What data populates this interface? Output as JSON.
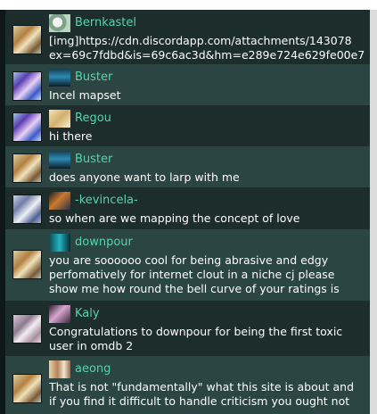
{
  "messages": [
    {
      "username": "Bernkastel",
      "mini_avatar_icon": "flower-avatar-icon",
      "lines": [
        "[img]https://cdn.discordapp.com/attachments/143078",
        "ex=69c7fdbd&is=69c6ac3d&hm=e289e724e629fe00e7"
      ]
    },
    {
      "username": "Buster",
      "mini_avatar_icon": "robot-avatar-icon",
      "lines": [
        "Incel mapset"
      ]
    },
    {
      "username": "Regou",
      "mini_avatar_icon": "blonde-avatar-icon",
      "lines": [
        "hi there"
      ]
    },
    {
      "username": "Buster",
      "mini_avatar_icon": "robot-avatar-icon",
      "lines": [
        "does anyone want to larp with me"
      ]
    },
    {
      "username": "-kevincela-",
      "mini_avatar_icon": "dark-hair-avatar-icon",
      "lines": [
        "so when are we mapping the concept of love"
      ]
    },
    {
      "username": "downpour",
      "mini_avatar_icon": "teal-avatar-icon",
      "lines": [
        "you are soooooo cool for being abrasive and edgy",
        "perfomatively for internet clout in a niche cj please",
        "show me how round the bell curve of your ratings is"
      ]
    },
    {
      "username": "Kaly",
      "mini_avatar_icon": "pink-avatar-icon",
      "lines": [
        "Congratulations to downpour for being the first toxic",
        "user in omdb 2"
      ]
    },
    {
      "username": "aeong",
      "mini_avatar_icon": "photo-avatar-icon",
      "lines": [
        "That is not \"fundamentally\" what this site is about and",
        "if you find it difficult to handle criticism you ought not"
      ]
    }
  ]
}
